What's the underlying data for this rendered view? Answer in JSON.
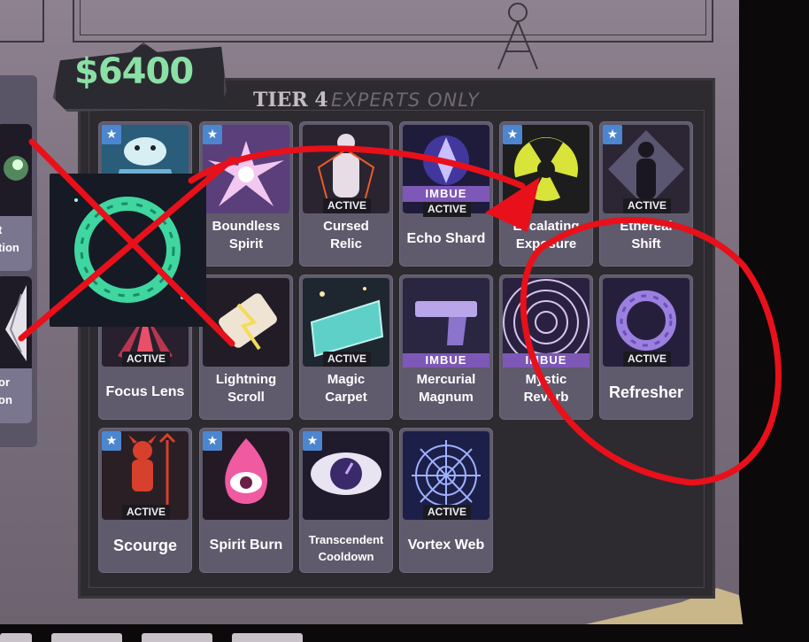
{
  "price": {
    "value": "$6400"
  },
  "tier": {
    "title": "TIER 4",
    "subtitle": "EXPERTS ONLY"
  },
  "left_column": [
    {
      "line1": "t",
      "line2": "tion"
    },
    {
      "line1": "or",
      "line2": "on"
    }
  ],
  "items": [
    {
      "name": "",
      "starred": true,
      "tag": "",
      "art": "ice-bear-icon",
      "colors": [
        "#2a5d7a",
        "#d8eef5"
      ]
    },
    {
      "name_line1": "Boundless",
      "name_line2": "Spirit",
      "starred": true,
      "tag": "",
      "art": "spirit-burst-icon"
    },
    {
      "name_line1": "Cursed",
      "name_line2": "Relic",
      "starred": false,
      "tag": "ACTIVE",
      "art": "cursed-figure-icon"
    },
    {
      "name": "Echo Shard",
      "starred": false,
      "tag": "IMBUE",
      "tag2": "ACTIVE",
      "art": "echo-shard-icon"
    },
    {
      "name_line1": "Escalating",
      "name_line2": "Exposure",
      "starred": true,
      "tag": "",
      "art": "radiation-icon"
    },
    {
      "name_line1": "Ethereal",
      "name_line2": "Shift",
      "starred": true,
      "tag": "ACTIVE",
      "art": "ghost-figure-icon"
    },
    {
      "name": "Focus Lens",
      "starred": false,
      "tag": "ACTIVE",
      "art": "focus-lens-icon"
    },
    {
      "name_line1": "Lightning",
      "name_line2": "Scroll",
      "starred": false,
      "tag": "",
      "art": "lightning-scroll-icon"
    },
    {
      "name_line1": "Magic",
      "name_line2": "Carpet",
      "starred": false,
      "tag": "ACTIVE",
      "art": "magic-carpet-icon"
    },
    {
      "name_line1": "Mercurial",
      "name_line2": "Magnum",
      "starred": false,
      "tag": "IMBUE",
      "art": "pistol-icon"
    },
    {
      "name_line1": "Mystic",
      "name_line2": "Reverb",
      "starred": false,
      "tag": "IMBUE",
      "art": "reverb-waves-icon"
    },
    {
      "name": "Refresher",
      "starred": false,
      "tag": "ACTIVE",
      "art": "ouroboros-icon"
    },
    {
      "name": "Scourge",
      "starred": true,
      "tag": "ACTIVE",
      "art": "devil-icon"
    },
    {
      "name": "Spirit Burn",
      "starred": true,
      "tag": "",
      "art": "spirit-flame-eye-icon"
    },
    {
      "name_line1": "Transcendent",
      "name_line2": "Cooldown",
      "starred": true,
      "tag": "",
      "art": "eye-clock-icon"
    },
    {
      "name": "Vortex Web",
      "starred": false,
      "tag": "ACTIVE",
      "art": "vortex-web-icon"
    }
  ],
  "annotation": {
    "color": "#e8101a",
    "marks": [
      "crossed-out-ouroboros",
      "arrow",
      "circle-around-refresher"
    ]
  }
}
